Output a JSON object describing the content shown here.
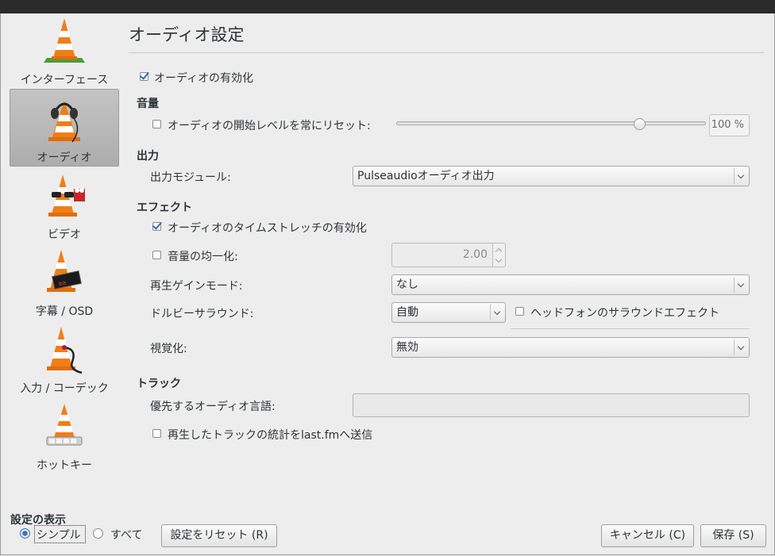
{
  "page_title": "オーディオ設定",
  "sidebar": {
    "items": [
      {
        "label": "インターフェース",
        "icon": "vlc-cone-interface-icon",
        "selected": false
      },
      {
        "label": "オーディオ",
        "icon": "vlc-cone-headphones-icon",
        "selected": true
      },
      {
        "label": "ビデオ",
        "icon": "vlc-cone-glasses-icon",
        "selected": false
      },
      {
        "label": "字幕 / OSD",
        "icon": "vlc-cone-subtitles-icon",
        "selected": false
      },
      {
        "label": "入力 / コーデック",
        "icon": "vlc-cone-cable-icon",
        "selected": false
      },
      {
        "label": "ホットキー",
        "icon": "vlc-cone-keys-icon",
        "selected": false
      }
    ]
  },
  "audio": {
    "enable_label": "オーディオの有効化",
    "enable_checked": true,
    "volume": {
      "section": "音量",
      "reset_label": "オーディオの開始レベルを常にリセット:",
      "reset_checked": false,
      "level_percent": 100,
      "value_text": "100 %"
    },
    "output": {
      "section": "出力",
      "module_label": "出力モジュール:",
      "module_value": "Pulseaudioオーディオ出力"
    },
    "effects": {
      "section": "エフェクト",
      "timestretch_label": "オーディオのタイムストレッチの有効化",
      "timestretch_checked": true,
      "normalize_label": "音量の均一化:",
      "normalize_checked": false,
      "normalize_value": "2.00",
      "replaygain_label": "再生ゲインモード:",
      "replaygain_value": "なし",
      "dolby_label": "ドルビーサラウンド:",
      "dolby_value": "自動",
      "headphone_label": "ヘッドフォンのサラウンドエフェクト",
      "headphone_checked": false,
      "visual_label": "視覚化:",
      "visual_value": "無効"
    },
    "tracks": {
      "section": "トラック",
      "preferred_lang_label": "優先するオーディオ言語:",
      "preferred_lang_value": "",
      "lastfm_label": "再生したトラックの統計をlast.fmへ送信",
      "lastfm_checked": false
    }
  },
  "footer": {
    "show_settings_label": "設定の表示",
    "simple_label": "シンプル",
    "all_label": "すべて",
    "selected_mode": "シンプル",
    "reset_button": "設定をリセット (R)",
    "cancel_button": "キャンセル (C)",
    "save_button": "保存 (S)"
  },
  "colors": {
    "cone_orange": "#f07e17",
    "selection_bg": "#b8b8b8",
    "check_blue": "#2f6bb5"
  }
}
